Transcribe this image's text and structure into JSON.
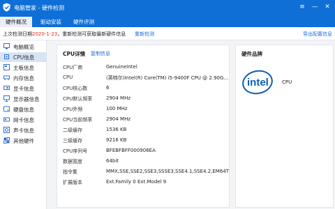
{
  "app": {
    "title": "电脑管家 - 硬件检测",
    "controls": {
      "menu": "≡",
      "minimize": "—",
      "close": "✕"
    }
  },
  "tabs": [
    {
      "label": "硬件概况",
      "active": true
    },
    {
      "label": "驱动安装",
      "active": false
    },
    {
      "label": "硬件评测",
      "active": false
    }
  ],
  "notice": {
    "prefix": "上次检测日期",
    "date": "2020-1-23",
    "suffix": "，重新检测可获取最新硬件信息",
    "redetect": "重新检测",
    "export": "导出配置信息"
  },
  "sidebar": {
    "items": [
      {
        "label": "电脑概览",
        "icon": "computer-icon",
        "active": false
      },
      {
        "label": "CPU信息",
        "icon": "cpu-icon",
        "active": true
      },
      {
        "label": "主板信息",
        "icon": "motherboard-icon",
        "active": false
      },
      {
        "label": "内存信息",
        "icon": "memory-icon",
        "active": false
      },
      {
        "label": "显卡信息",
        "icon": "graphics-card-icon",
        "active": false
      },
      {
        "label": "显示器信息",
        "icon": "monitor-icon",
        "active": false
      },
      {
        "label": "硬盘信息",
        "icon": "disk-icon",
        "active": false
      },
      {
        "label": "网卡信息",
        "icon": "network-card-icon",
        "active": false
      },
      {
        "label": "声卡信息",
        "icon": "sound-card-icon",
        "active": false
      },
      {
        "label": "其他硬件",
        "icon": "other-hardware-icon",
        "active": false
      }
    ]
  },
  "cpu": {
    "title": "CPU详情",
    "copy": "复制信息",
    "rows": [
      {
        "key": "CPU厂商",
        "value": "GenuineIntel"
      },
      {
        "key": "CPU",
        "value": "(英特尔)Intel(R) Core(TM) i5-9400F CPU @ 2.90G..."
      },
      {
        "key": "CPU核心数",
        "value": "6"
      },
      {
        "key": "CPU默认频率",
        "value": "2904 MHz"
      },
      {
        "key": "CPU外频",
        "value": "100 MHz"
      },
      {
        "key": "CPU当前频率",
        "value": "2904 MHz"
      },
      {
        "key": "二级缓存",
        "value": "1536 KB"
      },
      {
        "key": "三级缓存",
        "value": "9216 KB"
      },
      {
        "key": "CPU序列号",
        "value": "BFEBFBFF000906EA"
      },
      {
        "key": "数据宽度",
        "value": "64bit"
      },
      {
        "key": "指令集",
        "value": "MMX,SSE,SSE2,SSE3,SSSE3,SSE4.1,SSE4.2,EM64T"
      },
      {
        "key": "扩展版本",
        "value": "Ext.Family 0  Ext.Model 9"
      }
    ]
  },
  "brand": {
    "title": "硬件品牌",
    "logo_text": "intel",
    "item": "CPU"
  },
  "colors": {
    "titlebar": "#0f6fd6",
    "accent": "#1a6ad8",
    "date": "#e0261d",
    "intel": "#0a5eb3"
  }
}
